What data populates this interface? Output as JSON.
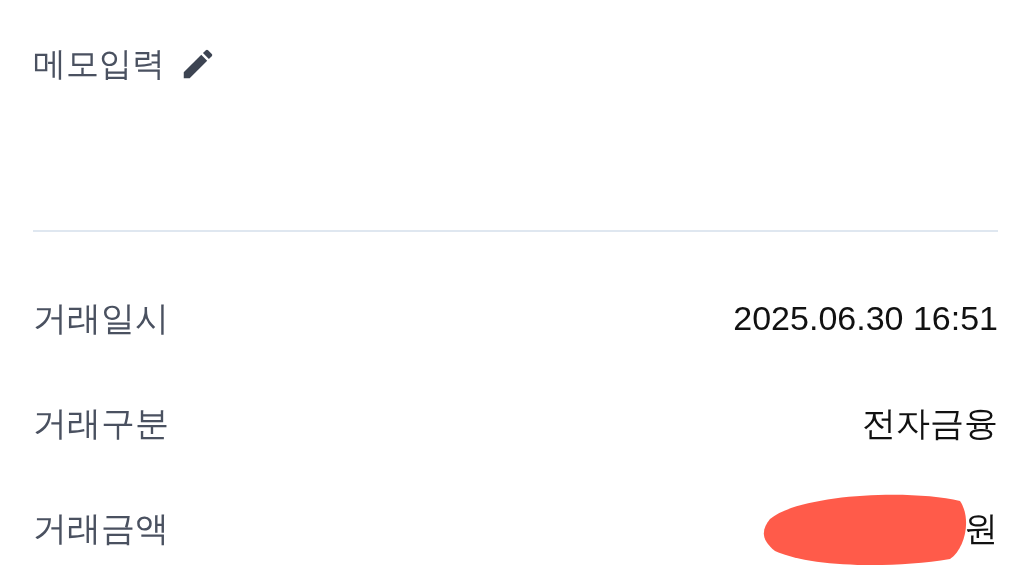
{
  "memo": {
    "label": "메모입력"
  },
  "details": [
    {
      "label": "거래일시",
      "value": "2025.06.30 16:51",
      "redacted": false
    },
    {
      "label": "거래구분",
      "value": "전자금융",
      "redacted": false
    },
    {
      "label": "거래금액",
      "value": "원",
      "redacted": true
    }
  ]
}
